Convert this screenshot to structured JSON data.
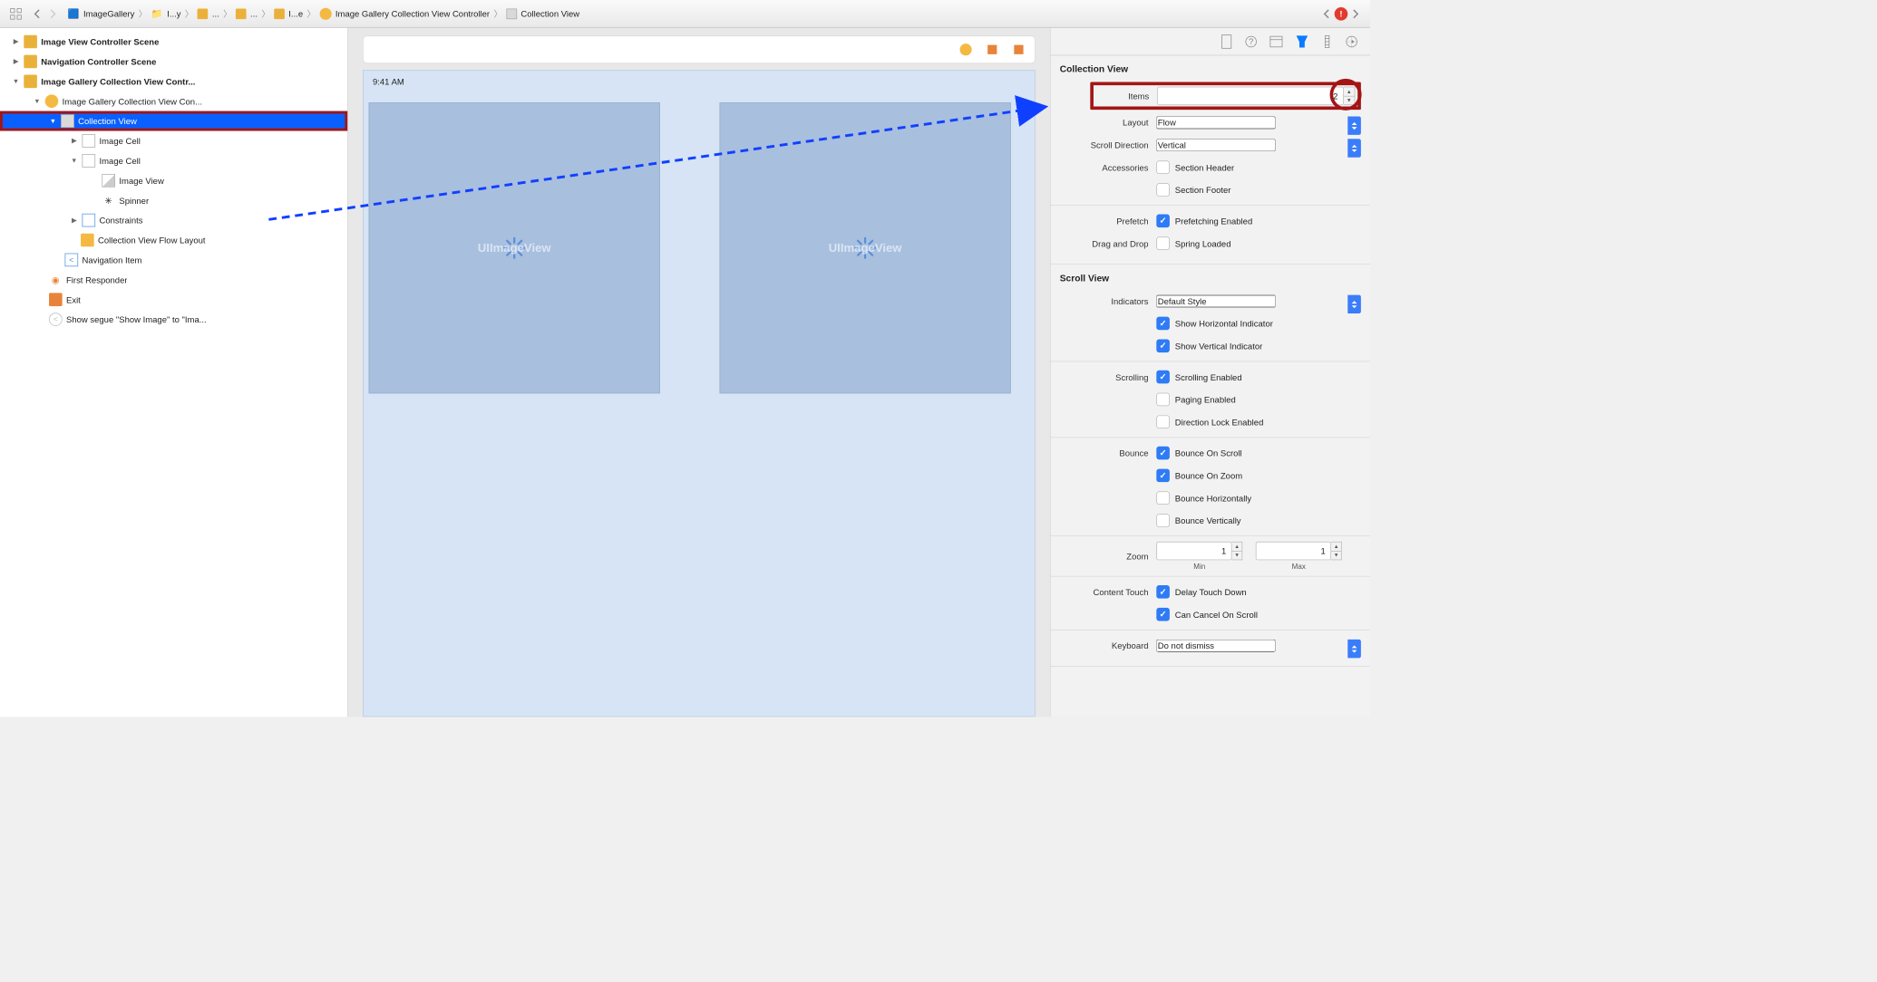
{
  "breadcrumbs": {
    "b0": "ImageGallery",
    "b1": "I...y",
    "b2": "...",
    "b3": "...",
    "b4": "I...e",
    "b5": "Image Gallery Collection View Controller",
    "b6": "Collection View"
  },
  "navigator": {
    "n0": "Image View Controller Scene",
    "n1": "Navigation Controller Scene",
    "n2": "Image Gallery Collection View Contr...",
    "n3": "Image Gallery Collection View Con...",
    "n4": "Collection View",
    "n5": "Image Cell",
    "n6": "Image Cell",
    "n7": "Image View",
    "n8": "Spinner",
    "n9": "Constraints",
    "n10": "Collection View Flow Layout",
    "n11": "Navigation Item",
    "n12": "First Responder",
    "n13": "Exit",
    "n14": "Show segue \"Show Image\" to \"Ima..."
  },
  "canvas": {
    "time": "9:41 AM",
    "cell_label": "UIImageView"
  },
  "inspector": {
    "cv_title": "Collection View",
    "items_label": "Items",
    "items_value": "2",
    "layout_label": "Layout",
    "layout_value": "Flow",
    "scrolldir_label": "Scroll Direction",
    "scrolldir_value": "Vertical",
    "accessories_label": "Accessories",
    "acc_header": "Section Header",
    "acc_footer": "Section Footer",
    "prefetch_label": "Prefetch",
    "prefetch_val": "Prefetching Enabled",
    "dragdrop_label": "Drag and Drop",
    "dragdrop_val": "Spring Loaded",
    "sv_title": "Scroll View",
    "indicators_label": "Indicators",
    "indicators_value": "Default Style",
    "show_h": "Show Horizontal Indicator",
    "show_v": "Show Vertical Indicator",
    "scrolling_label": "Scrolling",
    "scrolling_en": "Scrolling Enabled",
    "paging": "Paging Enabled",
    "dirlock": "Direction Lock Enabled",
    "bounce_label": "Bounce",
    "bos": "Bounce On Scroll",
    "boz": "Bounce On Zoom",
    "bh": "Bounce Horizontally",
    "bv": "Bounce Vertically",
    "zoom_label": "Zoom",
    "zoom_min": "1",
    "zoom_max": "1",
    "zmin_l": "Min",
    "zmax_l": "Max",
    "ct_label": "Content Touch",
    "ct_delay": "Delay Touch Down",
    "ct_cancel": "Can Cancel On Scroll",
    "kb_label": "Keyboard",
    "kb_value": "Do not dismiss"
  }
}
